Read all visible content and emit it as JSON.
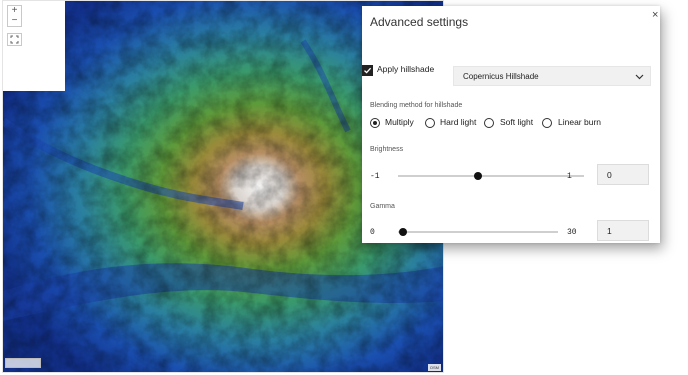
{
  "map": {
    "zoom_in": "+",
    "zoom_out": "−",
    "attribution": "OSM"
  },
  "panel": {
    "title": "Advanced settings",
    "close": "×",
    "hillshade": {
      "label": "Apply hillshade",
      "checked": true,
      "selected": "Copernicus Hillshade"
    },
    "blending": {
      "label": "Blending method for hillshade",
      "options": [
        "Multiply",
        "Hard light",
        "Soft light",
        "Linear burn"
      ],
      "selected_index": 0
    },
    "brightness": {
      "label": "Brightness",
      "min": "-1",
      "max": "1",
      "value": "0"
    },
    "gamma": {
      "label": "Gamma",
      "min": "0",
      "max": "30",
      "value": "1"
    }
  }
}
